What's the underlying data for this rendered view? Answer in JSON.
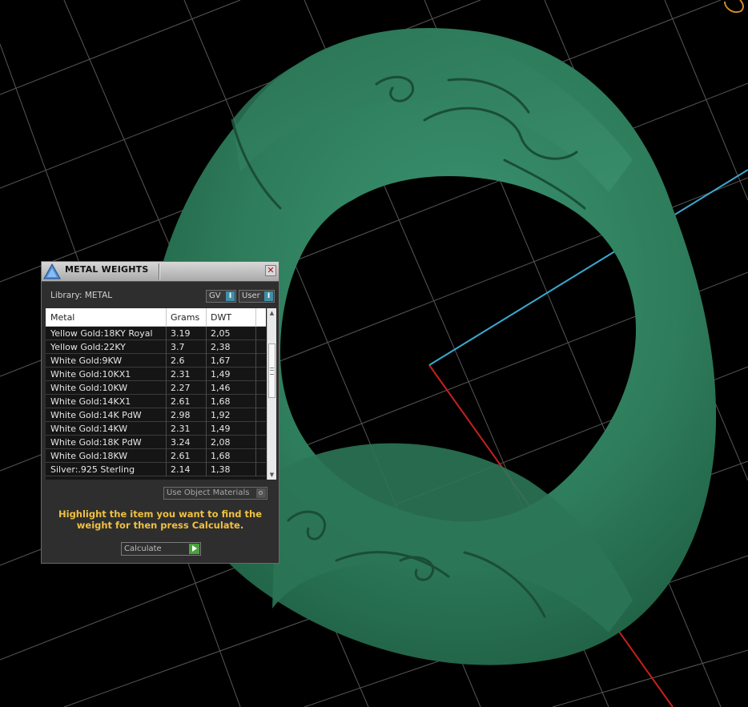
{
  "panel": {
    "title": "METAL WEIGHTS",
    "close_glyph": "✕",
    "library_label": "Library: METAL",
    "toggles": [
      {
        "label": "GV",
        "indicator": "I"
      },
      {
        "label": "User",
        "indicator": "I"
      }
    ],
    "table": {
      "headers": [
        "Metal",
        "Grams",
        "DWT"
      ],
      "rows": [
        {
          "metal": "Yellow Gold:18KY Royal",
          "grams": "3.19",
          "dwt": "2,05"
        },
        {
          "metal": "Yellow Gold:22KY",
          "grams": "3.7",
          "dwt": "2,38"
        },
        {
          "metal": "White Gold:9KW",
          "grams": "2.6",
          "dwt": "1,67"
        },
        {
          "metal": "White Gold:10KX1",
          "grams": "2.31",
          "dwt": "1,49"
        },
        {
          "metal": "White Gold:10KW",
          "grams": "2.27",
          "dwt": "1,46"
        },
        {
          "metal": "White Gold:14KX1",
          "grams": "2.61",
          "dwt": "1,68"
        },
        {
          "metal": "White Gold:14K PdW",
          "grams": "2.98",
          "dwt": "1,92"
        },
        {
          "metal": "White Gold:14KW",
          "grams": "2.31",
          "dwt": "1,49"
        },
        {
          "metal": "White Gold:18K PdW",
          "grams": "3.24",
          "dwt": "2,08"
        },
        {
          "metal": "White Gold:18KW",
          "grams": "2.61",
          "dwt": "1,68"
        },
        {
          "metal": "Silver:.925 Sterling",
          "grams": "2.14",
          "dwt": "1,38"
        }
      ]
    },
    "use_object_materials_label": "Use Object Materials",
    "instruction": "Highlight the item you want to find the weight for then press Calculate.",
    "calculate_label": "Calculate"
  },
  "colors": {
    "ring": "#2d7a5a",
    "grid": "#5a5a5a",
    "axis_x": "#c8201c",
    "axis_y": "#3aa9d0",
    "instruction_text": "#f0c040",
    "toggle_indicator": "#3f8fa8",
    "calculate_go": "#4aa23c"
  },
  "icons": {
    "app": "matrix-triangle-icon",
    "close": "close-icon",
    "scroll_up": "arrow-up-icon",
    "scroll_down": "arrow-down-icon",
    "go": "play-arrow-icon"
  }
}
